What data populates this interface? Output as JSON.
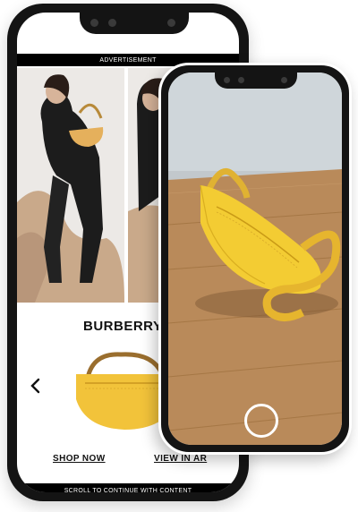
{
  "ad_banner": {
    "text": "ADVERTISEMENT"
  },
  "brand": {
    "name": "BURBERRY"
  },
  "carousel": {
    "prev_icon": "chevron-left-icon"
  },
  "actions": {
    "shop_now": "SHOP NOW",
    "view_in_ar": "VIEW IN AR"
  },
  "footer": {
    "scroll_text": "SCROLL TO CONTINUE WITH CONTENT"
  },
  "ar_view": {
    "capture_icon": "capture-circle-icon"
  },
  "colors": {
    "bag_yellow": "#f2c33a",
    "bag_strap": "#b88a3a",
    "ad_bar": "#000000",
    "phone_frame": "#141414",
    "floor_wood": "#b98a5a"
  }
}
